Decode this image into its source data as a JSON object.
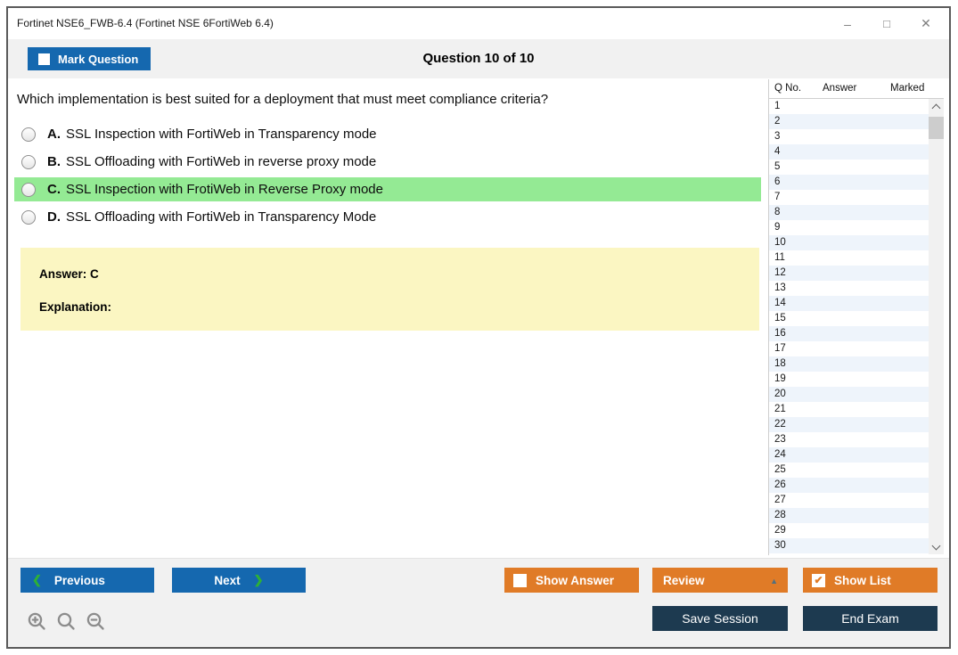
{
  "window": {
    "title": "Fortinet NSE6_FWB-6.4 (Fortinet NSE 6FortiWeb 6.4)",
    "icons": {
      "minimize": "–",
      "maximize": "□",
      "close": "✕"
    }
  },
  "toolbar": {
    "mark_question_label": "Mark Question",
    "mark_question_checked": false,
    "question_counter": "Question 10 of 10"
  },
  "question": {
    "text": "Which implementation is best suited for a deployment that must meet compliance criteria?",
    "options": [
      {
        "letter": "A.",
        "text": "SSL Inspection with FortiWeb in Transparency mode",
        "highlighted": false
      },
      {
        "letter": "B.",
        "text": "SSL Offloading with FortiWeb in reverse proxy mode",
        "highlighted": false
      },
      {
        "letter": "C.",
        "text": "SSL Inspection with FrotiWeb in Reverse Proxy mode",
        "highlighted": true
      },
      {
        "letter": "D.",
        "text": "SSL Offloading with FortiWeb in Transparency Mode",
        "highlighted": false
      }
    ],
    "answer_label": "Answer: C",
    "explanation_label": "Explanation:"
  },
  "question_list": {
    "headers": [
      "Q No.",
      "Answer",
      "Marked"
    ],
    "rows": [
      "1",
      "2",
      "3",
      "4",
      "5",
      "6",
      "7",
      "8",
      "9",
      "10",
      "11",
      "12",
      "13",
      "14",
      "15",
      "16",
      "17",
      "18",
      "19",
      "20",
      "21",
      "22",
      "23",
      "24",
      "25",
      "26",
      "27",
      "28",
      "29",
      "30"
    ]
  },
  "footer": {
    "previous_label": "Previous",
    "next_label": "Next",
    "show_answer_label": "Show Answer",
    "show_answer_checked": false,
    "review_label": "Review",
    "review_arrow": "▲",
    "show_list_label": "Show List",
    "show_list_checked": true,
    "show_list_check": "✔",
    "save_session_label": "Save Session",
    "end_exam_label": "End Exam",
    "chevron_left": "❮",
    "chevron_right": "❯"
  },
  "colors": {
    "accent_blue": "#1568af",
    "accent_orange": "#e07b27",
    "accent_navy": "#1d3a50",
    "highlight_green": "#94ea94",
    "answer_yellow": "#fbf6c2",
    "chevron_green": "#2eb135",
    "strip_gray": "#f1f1f1",
    "row_alt_blue": "#eef4fb"
  }
}
